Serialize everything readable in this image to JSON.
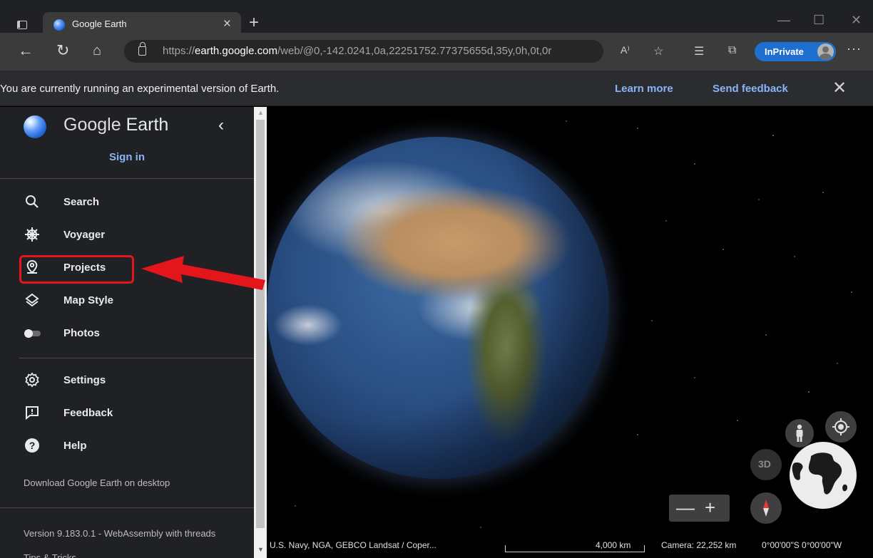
{
  "browser": {
    "tab_title": "Google Earth",
    "tab_close": "×",
    "new_tab": "+",
    "url_prefix": "https://",
    "url_domain": "earth.google.com",
    "url_path": "/web/@0,-142.0241,0a,22251752.77375655d,35y,0h,0t,0r",
    "inprivate_label": "InPrivate",
    "more_label": "···",
    "read_aloud_label": "A⁾",
    "minimize": "—",
    "maximize": "☐",
    "close": "✕"
  },
  "banner": {
    "message": "You are currently running an experimental version of Earth.",
    "learn_more": "Learn more",
    "send_feedback": "Send feedback",
    "close": "✕"
  },
  "sidebar": {
    "app_name_google": "Google",
    "app_name_earth": " Earth",
    "collapse": "‹",
    "sign_in": "Sign in",
    "items": [
      {
        "label": "Search"
      },
      {
        "label": "Voyager"
      },
      {
        "label": "Projects"
      },
      {
        "label": "Map Style"
      },
      {
        "label": "Photos"
      }
    ],
    "items2": [
      {
        "label": "Settings"
      },
      {
        "label": "Feedback"
      },
      {
        "label": "Help"
      }
    ],
    "download": "Download Google Earth on desktop",
    "version": "Version 9.183.0.1 - WebAssembly with threads",
    "tips": "Tips & Tricks"
  },
  "map": {
    "attribution": "U.S. Navy, NGA, GEBCO  Landsat / Coper...",
    "scale": "4,000 km",
    "camera": "Camera: 22,252 km",
    "coordinates": "0°00'00\"S 0°00'00\"W",
    "btn_3d": "3D",
    "zoom_out": "—",
    "zoom_in": "+"
  },
  "colors": {
    "accent_blue": "#8ab4f8",
    "highlight_red": "#e3161b",
    "sidebar_bg": "#202124"
  }
}
